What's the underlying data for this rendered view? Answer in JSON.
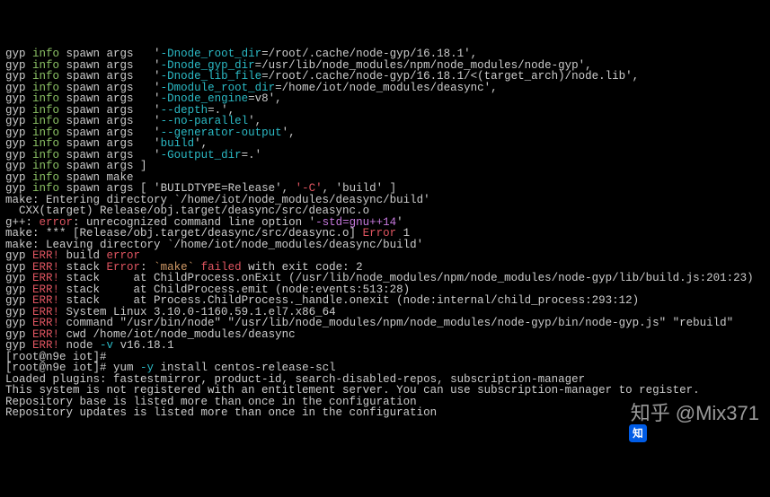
{
  "lines": [
    [
      [
        "gyp ",
        "white"
      ],
      [
        "info",
        "green"
      ],
      [
        " spawn args   '",
        "white"
      ],
      [
        "-Dnode_root_dir",
        "cyan"
      ],
      [
        "=/root/.cache/node-gyp/16.18.1',",
        "white"
      ]
    ],
    [
      [
        "gyp ",
        "white"
      ],
      [
        "info",
        "green"
      ],
      [
        " spawn args   '",
        "white"
      ],
      [
        "-Dnode_gyp_dir",
        "cyan"
      ],
      [
        "=/usr/lib/node_modules/npm/node_modules/node-gyp',",
        "white"
      ]
    ],
    [
      [
        "gyp ",
        "white"
      ],
      [
        "info",
        "green"
      ],
      [
        " spawn args   '",
        "white"
      ],
      [
        "-Dnode_lib_file",
        "cyan"
      ],
      [
        "=/root/.cache/node-gyp/16.18.1/<(target_arch)/node.lib',",
        "white"
      ]
    ],
    [
      [
        "gyp ",
        "white"
      ],
      [
        "info",
        "green"
      ],
      [
        " spawn args   '",
        "white"
      ],
      [
        "-Dmodule_root_dir",
        "cyan"
      ],
      [
        "=/home/iot/node_modules/deasync',",
        "white"
      ]
    ],
    [
      [
        "gyp ",
        "white"
      ],
      [
        "info",
        "green"
      ],
      [
        " spawn args   '",
        "white"
      ],
      [
        "-Dnode_engine",
        "cyan"
      ],
      [
        "=v8',",
        "white"
      ]
    ],
    [
      [
        "gyp ",
        "white"
      ],
      [
        "info",
        "green"
      ],
      [
        " spawn args   '",
        "white"
      ],
      [
        "--depth",
        "cyan"
      ],
      [
        "=.',",
        "white"
      ]
    ],
    [
      [
        "gyp ",
        "white"
      ],
      [
        "info",
        "green"
      ],
      [
        " spawn args   '",
        "white"
      ],
      [
        "--no-parallel",
        "cyan"
      ],
      [
        "',",
        "white"
      ]
    ],
    [
      [
        "gyp ",
        "white"
      ],
      [
        "info",
        "green"
      ],
      [
        " spawn args   '",
        "white"
      ],
      [
        "--generator-output",
        "cyan"
      ],
      [
        "',",
        "white"
      ]
    ],
    [
      [
        "gyp ",
        "white"
      ],
      [
        "info",
        "green"
      ],
      [
        " spawn args   '",
        "white"
      ],
      [
        "build",
        "cyan"
      ],
      [
        "',",
        "white"
      ]
    ],
    [
      [
        "gyp ",
        "white"
      ],
      [
        "info",
        "green"
      ],
      [
        " spawn args   '",
        "white"
      ],
      [
        "-Goutput_dir",
        "cyan"
      ],
      [
        "=.'",
        "white"
      ]
    ],
    [
      [
        "gyp ",
        "white"
      ],
      [
        "info",
        "green"
      ],
      [
        " spawn args ]",
        "white"
      ]
    ],
    [
      [
        "gyp ",
        "white"
      ],
      [
        "info",
        "green"
      ],
      [
        " spawn make",
        "white"
      ]
    ],
    [
      [
        "gyp ",
        "white"
      ],
      [
        "info",
        "green"
      ],
      [
        " spawn args [ '",
        "white"
      ],
      [
        "BUILDTYPE=Release",
        "white"
      ],
      [
        "', ",
        "white"
      ],
      [
        "'-C'",
        "red"
      ],
      [
        ", '",
        "white"
      ],
      [
        "build",
        "white"
      ],
      [
        "' ]",
        "white"
      ]
    ],
    [
      [
        "make: Entering directory `/home/iot/node_modules/deasync/build'",
        "white"
      ]
    ],
    [
      [
        "  CXX(target) Release/obj.target/deasync/src/deasync.o",
        "white"
      ]
    ],
    [
      [
        "g++: ",
        "white"
      ],
      [
        "error",
        "red"
      ],
      [
        ": unrecognized command line option '",
        "white"
      ],
      [
        "-std=gnu++14",
        "magenta"
      ],
      [
        "'",
        "white"
      ]
    ],
    [
      [
        "make: *** [Release/obj.target/deasync/src/deasync.o] ",
        "white"
      ],
      [
        "Error",
        "red"
      ],
      [
        " 1",
        "white"
      ]
    ],
    [
      [
        "make: Leaving directory `/home/iot/node_modules/deasync/build'",
        "white"
      ]
    ],
    [
      [
        "gyp ",
        "white"
      ],
      [
        "ERR!",
        "red"
      ],
      [
        " build ",
        "white"
      ],
      [
        "error",
        "red"
      ]
    ],
    [
      [
        "gyp ",
        "white"
      ],
      [
        "ERR!",
        "red"
      ],
      [
        " stack ",
        "white"
      ],
      [
        "Error",
        "red"
      ],
      [
        ": ",
        "white"
      ],
      [
        "`make`",
        "yellow"
      ],
      [
        " failed",
        "red"
      ],
      [
        " with exit code: 2",
        "white"
      ]
    ],
    [
      [
        "gyp ",
        "white"
      ],
      [
        "ERR!",
        "red"
      ],
      [
        " stack     at ChildProcess.onExit (/usr/lib/node_modules/npm/node_modules/node-gyp/lib/build.js:201:23)",
        "white"
      ]
    ],
    [
      [
        "gyp ",
        "white"
      ],
      [
        "ERR!",
        "red"
      ],
      [
        " stack     at ChildProcess.emit (node:events:513:28)",
        "white"
      ]
    ],
    [
      [
        "gyp ",
        "white"
      ],
      [
        "ERR!",
        "red"
      ],
      [
        " stack     at Process.ChildProcess._handle.onexit (node:internal/child_process:293:12)",
        "white"
      ]
    ],
    [
      [
        "gyp ",
        "white"
      ],
      [
        "ERR!",
        "red"
      ],
      [
        " System Linux 3.10.0-1160.59.1.el7.x86_64",
        "white"
      ]
    ],
    [
      [
        "gyp ",
        "white"
      ],
      [
        "ERR!",
        "red"
      ],
      [
        " command \"/usr/bin/node\" \"/usr/lib/node_modules/npm/node_modules/node-gyp/bin/node-gyp.js\" \"rebuild\"",
        "white"
      ]
    ],
    [
      [
        "gyp ",
        "white"
      ],
      [
        "ERR!",
        "red"
      ],
      [
        " cwd /home/iot/node_modules/deasync",
        "white"
      ]
    ],
    [
      [
        "gyp ",
        "white"
      ],
      [
        "ERR!",
        "red"
      ],
      [
        " node ",
        "white"
      ],
      [
        "-v",
        "cyan"
      ],
      [
        " v16.18.1",
        "white"
      ]
    ],
    [
      [
        "",
        "white"
      ]
    ],
    [
      [
        "",
        "white"
      ]
    ],
    [
      [
        "",
        "white"
      ]
    ],
    [
      [
        "[root@n9e iot]# ",
        "white"
      ]
    ],
    [
      [
        "[root@n9e iot]# yum ",
        "white"
      ],
      [
        "-y",
        "cyan"
      ],
      [
        " install centos-release-scl",
        "white"
      ]
    ],
    [
      [
        "Loaded plugins: fastestmirror, product-id, search-disabled-repos, subscription-manager",
        "white"
      ]
    ],
    [
      [
        "",
        "white"
      ]
    ],
    [
      [
        "This system is not registered with an entitlement server. You can use subscription-manager to register.",
        "white"
      ]
    ],
    [
      [
        "",
        "white"
      ]
    ],
    [
      [
        "Repository base is listed more than once in the configuration",
        "white"
      ]
    ],
    [
      [
        "Repository updates is listed more than once in the configuration",
        "white"
      ]
    ]
  ],
  "watermark": {
    "site": "知乎",
    "user": "@Mix371"
  }
}
